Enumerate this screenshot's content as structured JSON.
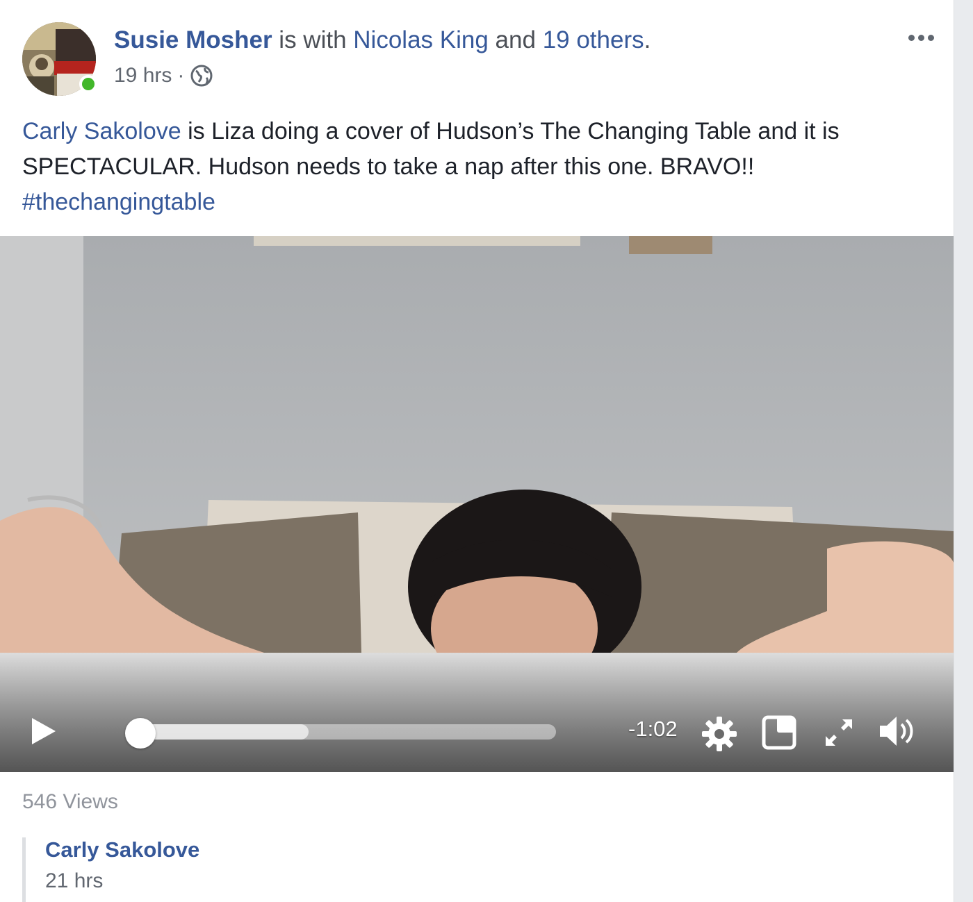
{
  "post": {
    "author": "Susie Mosher",
    "with_text": " is with ",
    "tagged_person": "Nicolas King",
    "and_text": " and ",
    "others": "19 others",
    "period": ".",
    "time": "19 hrs",
    "separator": "·",
    "privacy_icon": "globe-icon",
    "more_icon": "more-options-icon",
    "mention": "Carly Sakolove",
    "body": " is Liza doing a cover of Hudson’s The Changing Table and it is SPECTACULAR. Hudson needs to take a nap after this one. BRAVO!!",
    "hashtag": "#thechangingtable"
  },
  "video": {
    "play_icon": "play-icon",
    "progress_played_fraction": 0.0,
    "progress_buffered_fraction": 0.42,
    "time_remaining": "-1:02",
    "settings_icon": "gear-icon",
    "pip_icon": "picture-in-picture-icon",
    "fullscreen_icon": "fullscreen-icon",
    "volume_icon": "volume-icon"
  },
  "stats": {
    "views": "546 Views"
  },
  "comment": {
    "author": "Carly Sakolove",
    "time": "21 hrs"
  },
  "colors": {
    "link": "#365899",
    "text": "#1d2129",
    "muted": "#616770",
    "online": "#42b72a"
  }
}
